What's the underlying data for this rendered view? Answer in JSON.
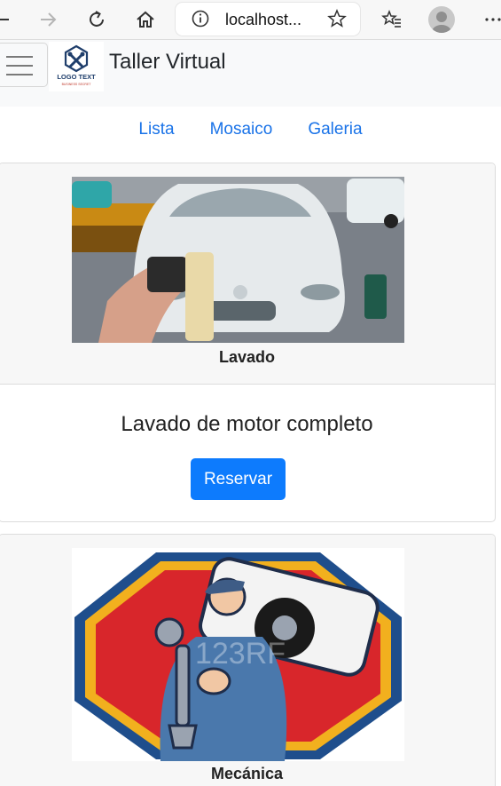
{
  "browser": {
    "url": "localhost...",
    "icons": [
      "back-icon",
      "forward-icon",
      "refresh-icon",
      "home-icon",
      "info-icon",
      "star-icon",
      "favorites-icon",
      "profile-icon",
      "more-icon"
    ]
  },
  "navbar": {
    "brand": "Taller Virtual",
    "logo_text": "LOGO TEXT",
    "logo_subtext": "BUSINESS SECRET"
  },
  "tabs": [
    {
      "label": "Lista"
    },
    {
      "label": "Mosaico"
    },
    {
      "label": "Galeria"
    }
  ],
  "services": [
    {
      "caption": "Lavado",
      "description": "Lavado de motor completo",
      "button": "Reservar"
    },
    {
      "caption": "Mecánica"
    }
  ],
  "colors": {
    "link": "#1a73e8",
    "button": "#0d7bfd",
    "mechanic_red": "#d8262b",
    "mechanic_blue": "#1f4e8c",
    "mechanic_gold": "#f2b01e"
  }
}
